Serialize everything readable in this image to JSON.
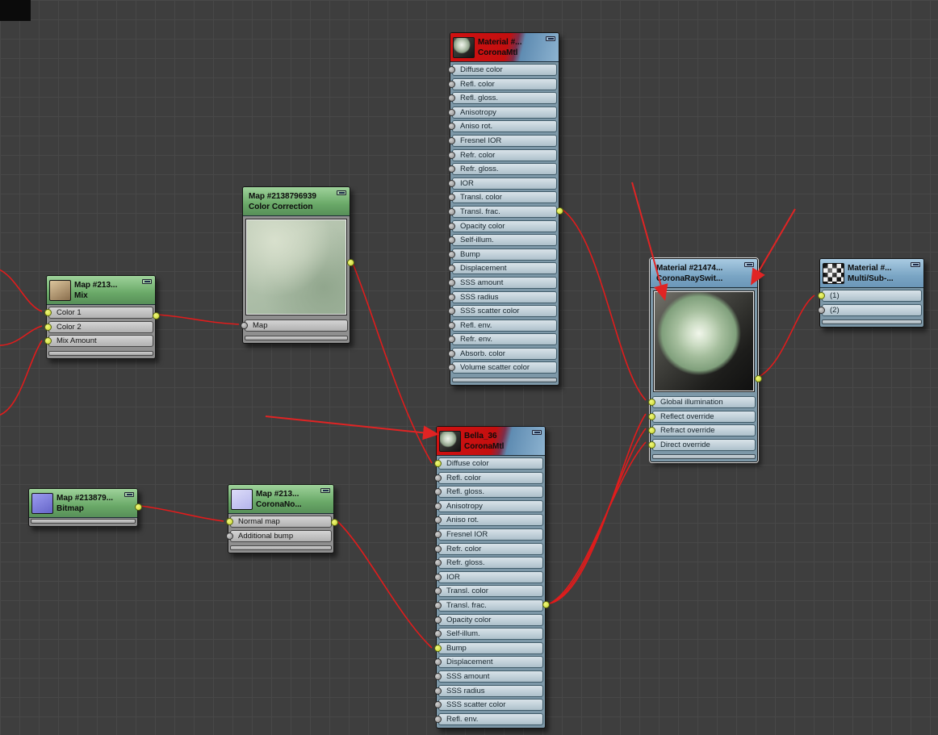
{
  "canvas": {
    "background": "#3e3e3e",
    "grid_line": "#484848",
    "wire_color": "#e01c1c",
    "arrow_color": "#e02424",
    "socket_connected_color": "#ccd935",
    "socket_free_color": "#a8a8a8"
  },
  "nodes": {
    "corona_top": {
      "title": "Material #...",
      "subtitle": "CoronaMtl",
      "slots": [
        {
          "label": "Diffuse color",
          "dot": "g"
        },
        {
          "label": "Refl. color",
          "dot": "g"
        },
        {
          "label": "Refl. gloss.",
          "dot": "g"
        },
        {
          "label": "Anisotropy",
          "dot": "g"
        },
        {
          "label": "Aniso rot.",
          "dot": "g"
        },
        {
          "label": "Fresnel IOR",
          "dot": "g"
        },
        {
          "label": "Refr. color",
          "dot": "g"
        },
        {
          "label": "Refr. gloss.",
          "dot": "g"
        },
        {
          "label": "IOR",
          "dot": "g"
        },
        {
          "label": "Transl. color",
          "dot": "g"
        },
        {
          "label": "Transl. frac.",
          "dot": "g"
        },
        {
          "label": "Opacity color",
          "dot": "g"
        },
        {
          "label": "Self-illum.",
          "dot": "g"
        },
        {
          "label": "Bump",
          "dot": "g"
        },
        {
          "label": "Displacement",
          "dot": "g"
        },
        {
          "label": "SSS amount",
          "dot": "g"
        },
        {
          "label": "SSS radius",
          "dot": "g"
        },
        {
          "label": "SSS scatter color",
          "dot": "g"
        },
        {
          "label": "Refl. env.",
          "dot": "g"
        },
        {
          "label": "Refr. env.",
          "dot": "g"
        },
        {
          "label": "Absorb. color",
          "dot": "g"
        },
        {
          "label": "Volume scatter color",
          "dot": "g"
        }
      ]
    },
    "color_correction": {
      "title": "Map #2138796939",
      "subtitle": "Color Correction",
      "slots": [
        {
          "label": "Map",
          "dot": "g"
        }
      ]
    },
    "mix": {
      "title": "Map #213...",
      "subtitle": "Mix",
      "slots": [
        {
          "label": "Color 1",
          "dot": "y"
        },
        {
          "label": "Color 2",
          "dot": "y"
        },
        {
          "label": "Mix Amount",
          "dot": "y"
        }
      ]
    },
    "bitmap": {
      "title": "Map #213879...",
      "subtitle": "Bitmap"
    },
    "corona_normal": {
      "title": "Map #213...",
      "subtitle": "CoronaNo...",
      "slots": [
        {
          "label": "Normal map",
          "dot": "y"
        },
        {
          "label": "Additional bump",
          "dot": "g"
        }
      ]
    },
    "bella": {
      "title": "Bella_36",
      "subtitle": "CoronaMtl",
      "slots": [
        {
          "label": "Diffuse color",
          "dot": "y"
        },
        {
          "label": "Refl. color",
          "dot": "g"
        },
        {
          "label": "Refl. gloss.",
          "dot": "g"
        },
        {
          "label": "Anisotropy",
          "dot": "g"
        },
        {
          "label": "Aniso rot.",
          "dot": "g"
        },
        {
          "label": "Fresnel IOR",
          "dot": "g"
        },
        {
          "label": "Refr. color",
          "dot": "g"
        },
        {
          "label": "Refr. gloss.",
          "dot": "g"
        },
        {
          "label": "IOR",
          "dot": "g"
        },
        {
          "label": "Transl. color",
          "dot": "g"
        },
        {
          "label": "Transl. frac.",
          "dot": "g"
        },
        {
          "label": "Opacity color",
          "dot": "g"
        },
        {
          "label": "Self-illum.",
          "dot": "g"
        },
        {
          "label": "Bump",
          "dot": "y"
        },
        {
          "label": "Displacement",
          "dot": "g"
        },
        {
          "label": "SSS amount",
          "dot": "g"
        },
        {
          "label": "SSS radius",
          "dot": "g"
        },
        {
          "label": "SSS scatter color",
          "dot": "g"
        },
        {
          "label": "Refl. env.",
          "dot": "g"
        }
      ]
    },
    "rayswitch": {
      "title": "Material #21474...",
      "subtitle": "CoronaRaySwit...",
      "slots": [
        {
          "label": "Global illumination",
          "dot": "y"
        },
        {
          "label": "Reflect override",
          "dot": "y"
        },
        {
          "label": "Refract override",
          "dot": "y"
        },
        {
          "label": "Direct override",
          "dot": "y"
        }
      ]
    },
    "multisub": {
      "title": "Material #...",
      "subtitle": "Multi/Sub-...",
      "slots": [
        {
          "label": "(1)",
          "dot": "y"
        },
        {
          "label": "(2)",
          "dot": "g"
        }
      ]
    }
  },
  "connections": [
    {
      "from": "offscreen-left",
      "to": "mix.Color 1"
    },
    {
      "from": "offscreen-left",
      "to": "mix.Color 2"
    },
    {
      "from": "offscreen-left",
      "to": "mix.Mix Amount"
    },
    {
      "from": "mix.output",
      "to": "color_correction.Map"
    },
    {
      "from": "color_correction.output",
      "to": "bella.Diffuse color"
    },
    {
      "from": "corona_top.output",
      "to": "rayswitch.Global illumination"
    },
    {
      "from": "bitmap.output",
      "to": "corona_normal.Normal map"
    },
    {
      "from": "corona_normal.output",
      "to": "bella.Bump"
    },
    {
      "from": "bella.output",
      "to": "rayswitch.Reflect override"
    },
    {
      "from": "bella.output",
      "to": "rayswitch.Refract override"
    },
    {
      "from": "bella.output",
      "to": "rayswitch.Direct override"
    },
    {
      "from": "rayswitch.output",
      "to": "multisub.(1)"
    }
  ]
}
